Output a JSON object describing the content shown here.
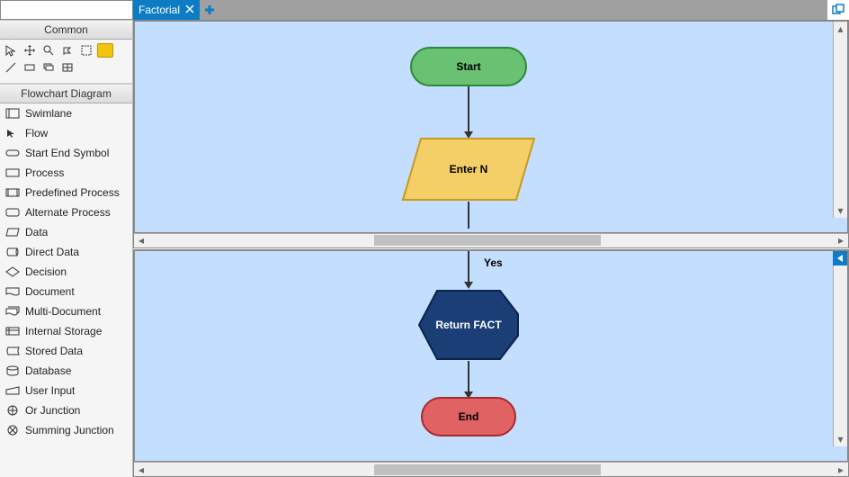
{
  "sidebar": {
    "search_placeholder": "",
    "common_header": "Common",
    "flowchart_header": "Flowchart Diagram",
    "shapes": [
      "Swimlane",
      "Flow",
      "Start End Symbol",
      "Process",
      "Predefined Process",
      "Alternate Process",
      "Data",
      "Direct Data",
      "Decision",
      "Document",
      "Multi-Document",
      "Internal Storage",
      "Stored Data",
      "Database",
      "User Input",
      "Or Junction",
      "Summing Junction"
    ]
  },
  "tab": {
    "title": "Factorial"
  },
  "diagram": {
    "top": {
      "start": "Start",
      "input": "Enter N"
    },
    "bottom": {
      "branch_label": "Yes",
      "display": "Return FACT",
      "end": "End"
    }
  }
}
